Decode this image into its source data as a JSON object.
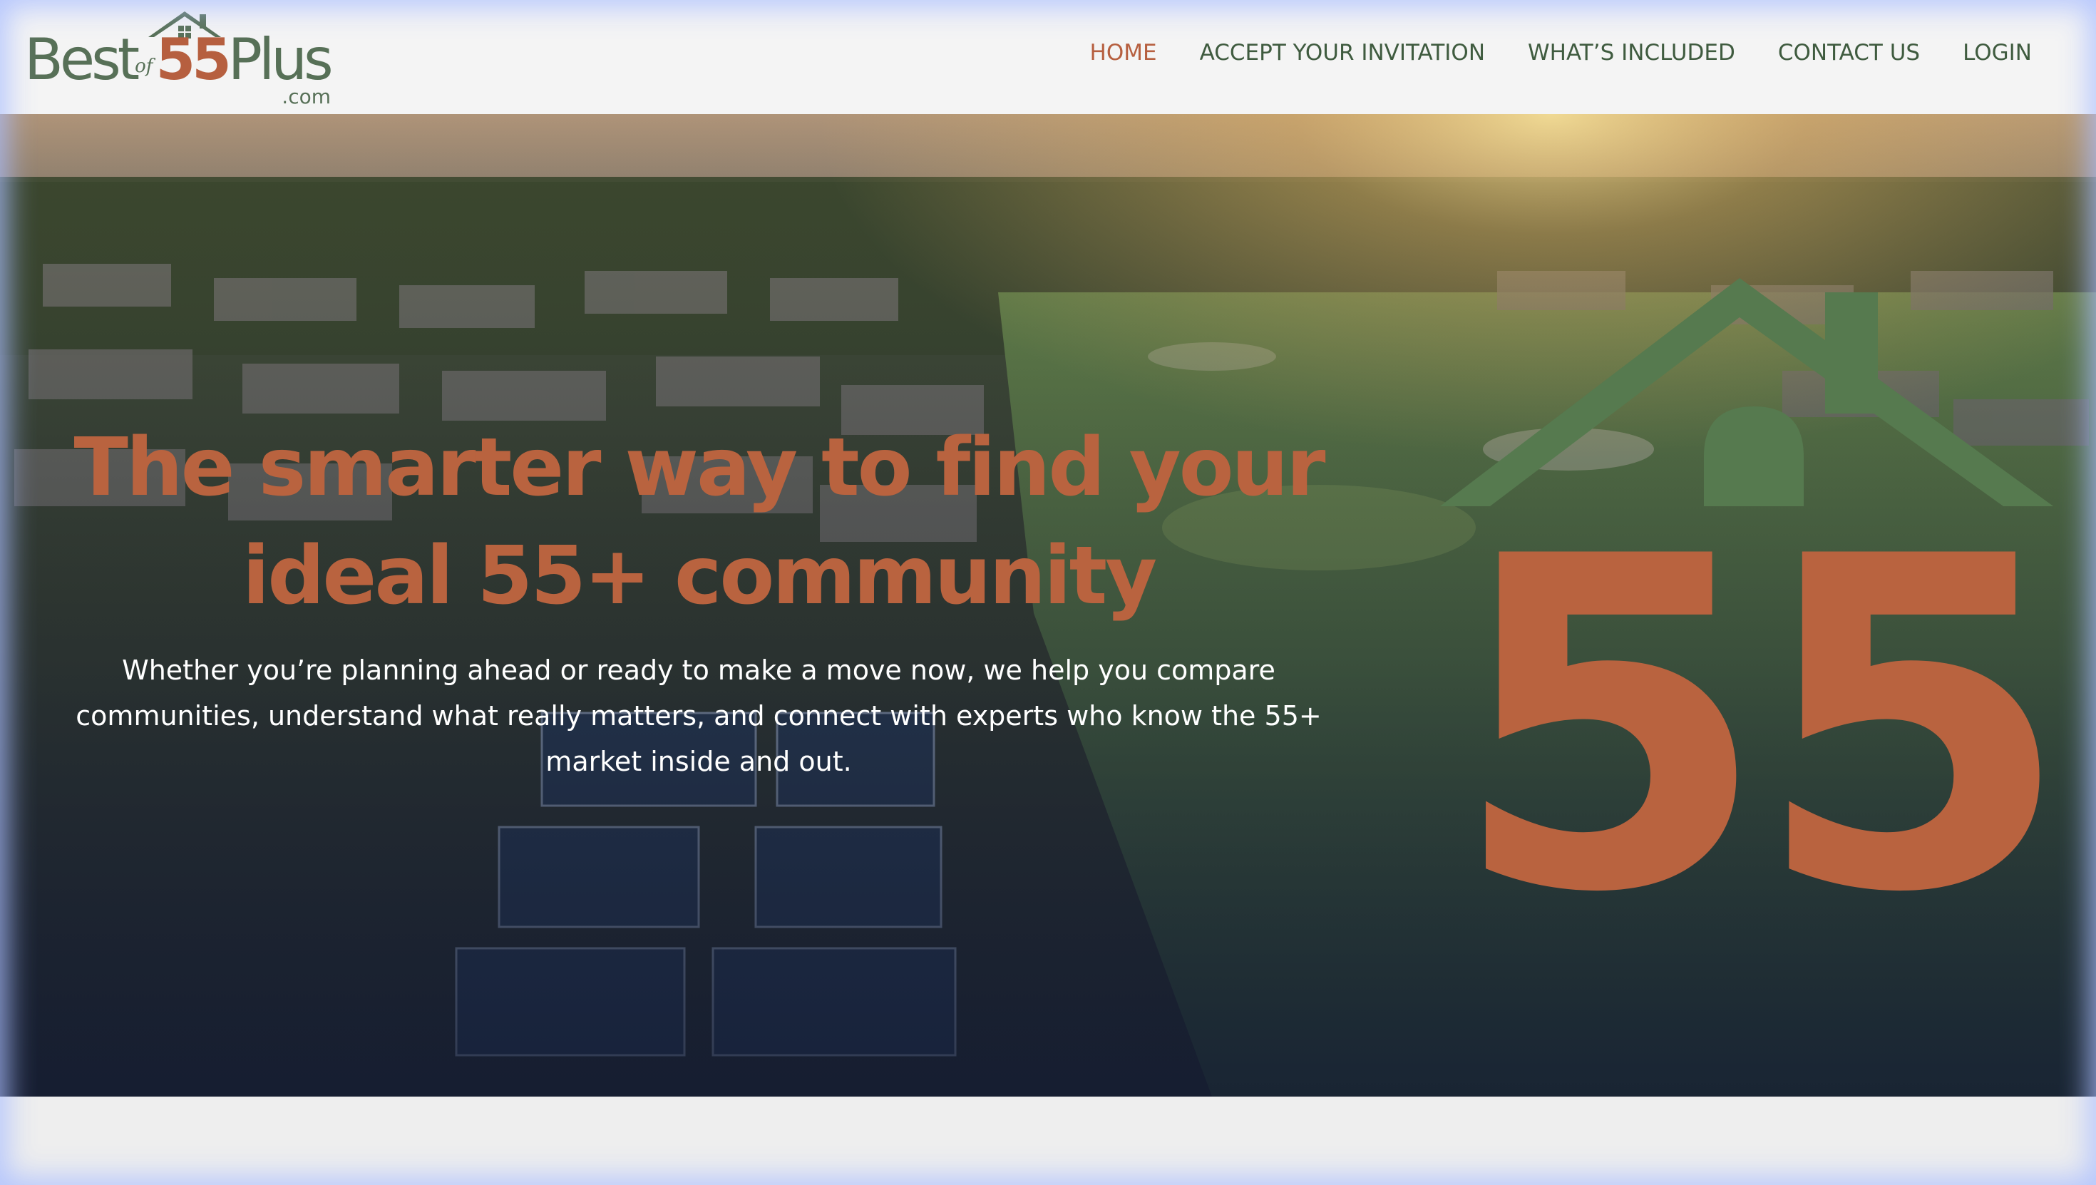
{
  "logo": {
    "best": "Best",
    "of": "of",
    "number": "55",
    "plus": "Plus",
    "com": ".com",
    "icon": "house-icon"
  },
  "nav": {
    "items": [
      {
        "label": "HOME",
        "active": true
      },
      {
        "label": "ACCEPT YOUR INVITATION",
        "active": false
      },
      {
        "label": "WHAT’S INCLUDED",
        "active": false
      },
      {
        "label": "CONTACT US",
        "active": false
      },
      {
        "label": "LOGIN",
        "active": false
      }
    ]
  },
  "hero": {
    "title_line1": "The smarter way to find your",
    "title_line2": "ideal 55+ community",
    "subtitle_line1": "Whether you’re planning ahead or ready to make a move now, we help you compare",
    "subtitle_line2": "communities, understand what really matters, and connect with experts who know the 55+",
    "subtitle_line3": "market inside and out.",
    "graphic_number": "55",
    "graphic_icon": "house-roof-icon"
  },
  "colors": {
    "brand_green": "#577057",
    "brand_orange": "#b65f3f",
    "nav_text": "#3f5b3f",
    "header_bg": "#f4f4f4",
    "hero_overlay": "#1d2540"
  }
}
